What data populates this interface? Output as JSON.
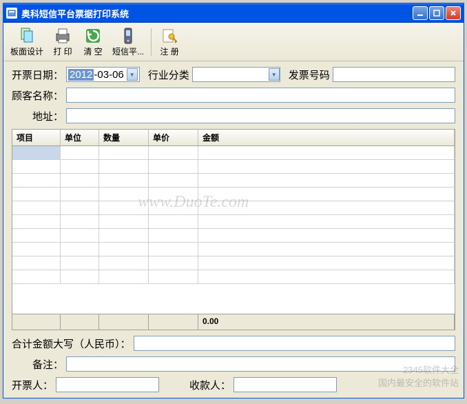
{
  "window": {
    "title": "奥科短信平台票据打印系统"
  },
  "toolbar": {
    "design": "板面设计",
    "print": "打 印",
    "clear": "清 空",
    "sms": "短信平...",
    "register": "注 册"
  },
  "form": {
    "date_label": "开票日期：",
    "date_year": "2012",
    "date_rest": "-03-06",
    "category_label": "行业分类",
    "invoice_no_label": "发票号码",
    "customer_label": "顾客名称：",
    "address_label": "地址：",
    "total_caps_label": "合计金额大写（人民币）：",
    "remark_label": "备注：",
    "issuer_label": "开票人：",
    "payee_label": "收款人："
  },
  "grid": {
    "columns": [
      "项目",
      "单位",
      "数量",
      "单价",
      "金额"
    ],
    "footer_total": "0.00"
  },
  "watermark": "www.DuoTe.com",
  "watermark2_line1": "2345软件大全",
  "watermark2_line2": "国内最安全的软件站"
}
